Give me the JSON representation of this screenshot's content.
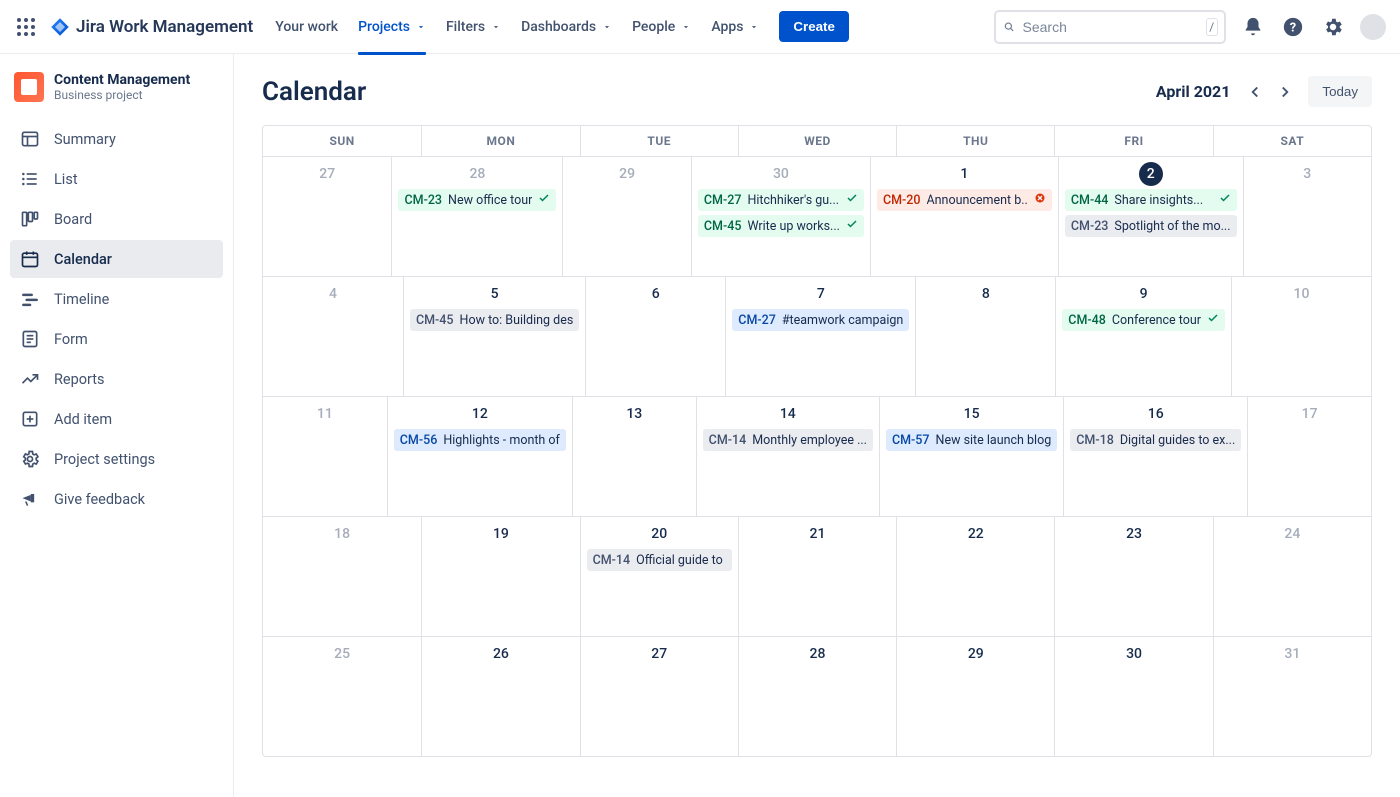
{
  "topnav": {
    "product": "Jira Work Management",
    "items": [
      {
        "label": "Your work",
        "dropdown": false
      },
      {
        "label": "Projects",
        "dropdown": true,
        "active": true
      },
      {
        "label": "Filters",
        "dropdown": true
      },
      {
        "label": "Dashboards",
        "dropdown": true
      },
      {
        "label": "People",
        "dropdown": true
      },
      {
        "label": "Apps",
        "dropdown": true
      }
    ],
    "create": "Create",
    "search_placeholder": "Search",
    "search_kbd": "/"
  },
  "sidebar": {
    "project": {
      "name": "Content Management",
      "type": "Business project"
    },
    "items": [
      {
        "label": "Summary",
        "icon": "summary"
      },
      {
        "label": "List",
        "icon": "list"
      },
      {
        "label": "Board",
        "icon": "board"
      },
      {
        "label": "Calendar",
        "icon": "calendar",
        "selected": true
      },
      {
        "label": "Timeline",
        "icon": "timeline"
      },
      {
        "label": "Form",
        "icon": "form"
      },
      {
        "label": "Reports",
        "icon": "reports"
      },
      {
        "label": "Add item",
        "icon": "add"
      },
      {
        "label": "Project settings",
        "icon": "settings"
      },
      {
        "label": "Give feedback",
        "icon": "feedback"
      }
    ]
  },
  "main": {
    "title": "Calendar",
    "month": "April 2021",
    "today": "Today"
  },
  "calendar": {
    "dow": [
      "SUN",
      "MON",
      "TUE",
      "WED",
      "THU",
      "FRI",
      "SAT"
    ],
    "today_index": {
      "week": 0,
      "col": 5
    },
    "weeks": [
      [
        {
          "n": "27",
          "muted": true,
          "events": []
        },
        {
          "n": "28",
          "muted": true,
          "events": [
            {
              "key": "CM-23",
              "title": "New office tour",
              "color": "green",
              "done": true
            }
          ]
        },
        {
          "n": "29",
          "muted": true,
          "events": []
        },
        {
          "n": "30",
          "muted": true,
          "events": [
            {
              "key": "CM-27",
              "title": "Hitchhiker's gu...",
              "color": "green",
              "done": true
            },
            {
              "key": "CM-45",
              "title": "Write up works...",
              "color": "green",
              "done": true
            }
          ]
        },
        {
          "n": "1",
          "events": [
            {
              "key": "CM-20",
              "title": "Announcement b..",
              "color": "red",
              "err": true
            }
          ]
        },
        {
          "n": "2",
          "events": [
            {
              "key": "CM-44",
              "title": "Share insights...",
              "color": "green",
              "done": true
            },
            {
              "key": "CM-23",
              "title": "Spotlight of the mo...",
              "color": "grey"
            }
          ]
        },
        {
          "n": "3",
          "muted": true,
          "events": []
        }
      ],
      [
        {
          "n": "4",
          "muted": true,
          "events": []
        },
        {
          "n": "5",
          "events": [
            {
              "key": "CM-45",
              "title": "How to: Building des",
              "color": "grey"
            }
          ]
        },
        {
          "n": "6",
          "events": []
        },
        {
          "n": "7",
          "events": [
            {
              "key": "CM-27",
              "title": "#teamwork campaign",
              "color": "blue"
            }
          ]
        },
        {
          "n": "8",
          "events": []
        },
        {
          "n": "9",
          "events": [
            {
              "key": "CM-48",
              "title": "Conference tour",
              "color": "green",
              "done": true
            }
          ]
        },
        {
          "n": "10",
          "muted": true,
          "events": []
        }
      ],
      [
        {
          "n": "11",
          "muted": true,
          "events": []
        },
        {
          "n": "12",
          "events": [
            {
              "key": "CM-56",
              "title": "Highlights - month of",
              "color": "blue"
            }
          ]
        },
        {
          "n": "13",
          "events": []
        },
        {
          "n": "14",
          "events": [
            {
              "key": "CM-14",
              "title": "Monthly employee ...",
              "color": "grey"
            }
          ]
        },
        {
          "n": "15",
          "events": [
            {
              "key": "CM-57",
              "title": "New site launch blog",
              "color": "blue"
            }
          ]
        },
        {
          "n": "16",
          "events": [
            {
              "key": "CM-18",
              "title": "Digital guides to ex...",
              "color": "grey"
            }
          ]
        },
        {
          "n": "17",
          "muted": true,
          "events": []
        }
      ],
      [
        {
          "n": "18",
          "muted": true,
          "events": []
        },
        {
          "n": "19",
          "events": []
        },
        {
          "n": "20",
          "events": [
            {
              "key": "CM-14",
              "title": "Official guide to",
              "color": "grey"
            }
          ]
        },
        {
          "n": "21",
          "events": []
        },
        {
          "n": "22",
          "events": []
        },
        {
          "n": "23",
          "events": []
        },
        {
          "n": "24",
          "muted": true,
          "events": []
        }
      ],
      [
        {
          "n": "25",
          "muted": true,
          "events": []
        },
        {
          "n": "26",
          "events": []
        },
        {
          "n": "27",
          "events": []
        },
        {
          "n": "28",
          "events": []
        },
        {
          "n": "29",
          "events": []
        },
        {
          "n": "30",
          "events": []
        },
        {
          "n": "31",
          "muted": true,
          "events": []
        }
      ]
    ]
  }
}
